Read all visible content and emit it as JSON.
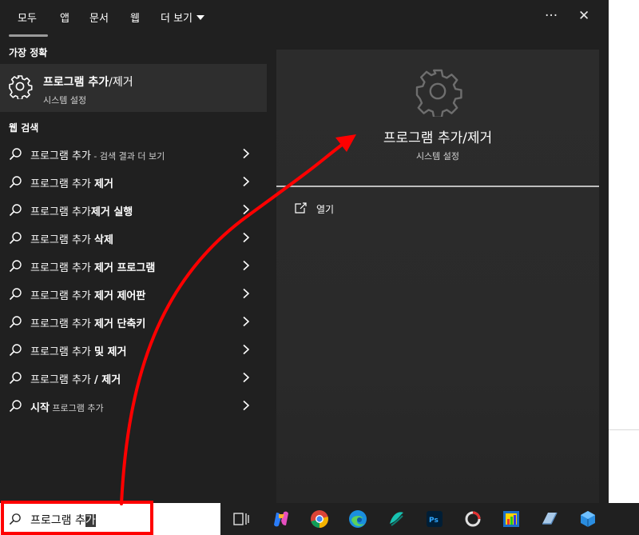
{
  "tabs": {
    "all": "모두",
    "apps": "앱",
    "documents": "문서",
    "web": "웹",
    "more": "더 보기"
  },
  "window_controls": {
    "more": "···",
    "close": "✕"
  },
  "best_match": {
    "heading": "가장 정확",
    "name_bold": "프로그램 추가",
    "name_rest": "/제거",
    "subtitle": "시스템 설정",
    "icon": "gear-icon"
  },
  "web_search": {
    "heading": "웹 검색",
    "items": [
      {
        "normal": "프로그램 추가",
        "bold": "",
        "suffix": " - 검색 결과 더 보기"
      },
      {
        "normal": "프로그램 추가 ",
        "bold": "제거",
        "suffix": ""
      },
      {
        "normal": "프로그램 추가",
        "bold": "제거 실행",
        "suffix": ""
      },
      {
        "normal": "프로그램 추가 ",
        "bold": "삭제",
        "suffix": ""
      },
      {
        "normal": "프로그램 추가 ",
        "bold": "제거 프로그램",
        "suffix": ""
      },
      {
        "normal": "프로그램 추가 ",
        "bold": "제거 제어판",
        "suffix": ""
      },
      {
        "normal": "프로그램 추가 ",
        "bold": "제거 단축키",
        "suffix": ""
      },
      {
        "normal": "프로그램 추가 ",
        "bold": "및 제거",
        "suffix": ""
      },
      {
        "normal": "프로그램 추가 ",
        "bold": "/ 제거",
        "suffix": ""
      },
      {
        "normal": "",
        "bold": "시작",
        "suffix": " 프로그램 추가"
      }
    ]
  },
  "detail": {
    "title": "프로그램 추가/제거",
    "subtitle": "시스템 설정",
    "open_label": "열기"
  },
  "taskbar": {
    "search_query_plain": "프로그램 추",
    "search_query_selected": "가",
    "apps": [
      "task-view",
      "copilot",
      "chrome",
      "edge",
      "app-teal",
      "photoshop",
      "app-circle",
      "app-chart",
      "app-blue",
      "app-cube"
    ]
  },
  "colors": {
    "panel_bg": "#202020",
    "highlight_bg": "#2e2e2e",
    "detail_bg": "#2a2a2a",
    "annotation_red": "#ff0000"
  }
}
